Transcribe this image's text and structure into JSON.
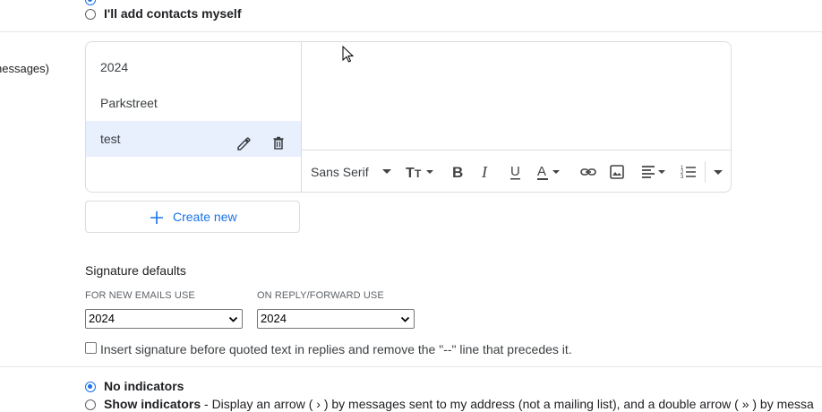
{
  "contact_option": {
    "label": "I'll add contacts myself"
  },
  "left_label_fragment": "nessages)",
  "signatures": {
    "items": [
      {
        "label": "2024"
      },
      {
        "label": "Parkstreet"
      },
      {
        "label": "test"
      }
    ],
    "selected_index": 2,
    "toolbar": {
      "font_label": "Sans Serif"
    },
    "create_new_label": "Create new"
  },
  "signature_defaults": {
    "heading": "Signature defaults",
    "new_emails_caption": "FOR NEW EMAILS USE",
    "new_emails_value": "2024",
    "reply_caption": "ON REPLY/FORWARD USE",
    "reply_value": "2024",
    "insert_before_label": "Insert signature before quoted text in replies and remove the \"--\" line that precedes it."
  },
  "indicators": {
    "no_indicators_label": "No indicators",
    "show_indicators_label": "Show indicators",
    "show_indicators_desc": " - Display an arrow ( › ) by messages sent to my address (not a mailing list), and a double arrow ( » ) by messa"
  },
  "colors": {
    "accent": "#1a73e8",
    "selected_bg": "#e8f0fe",
    "border": "#dadce0"
  }
}
